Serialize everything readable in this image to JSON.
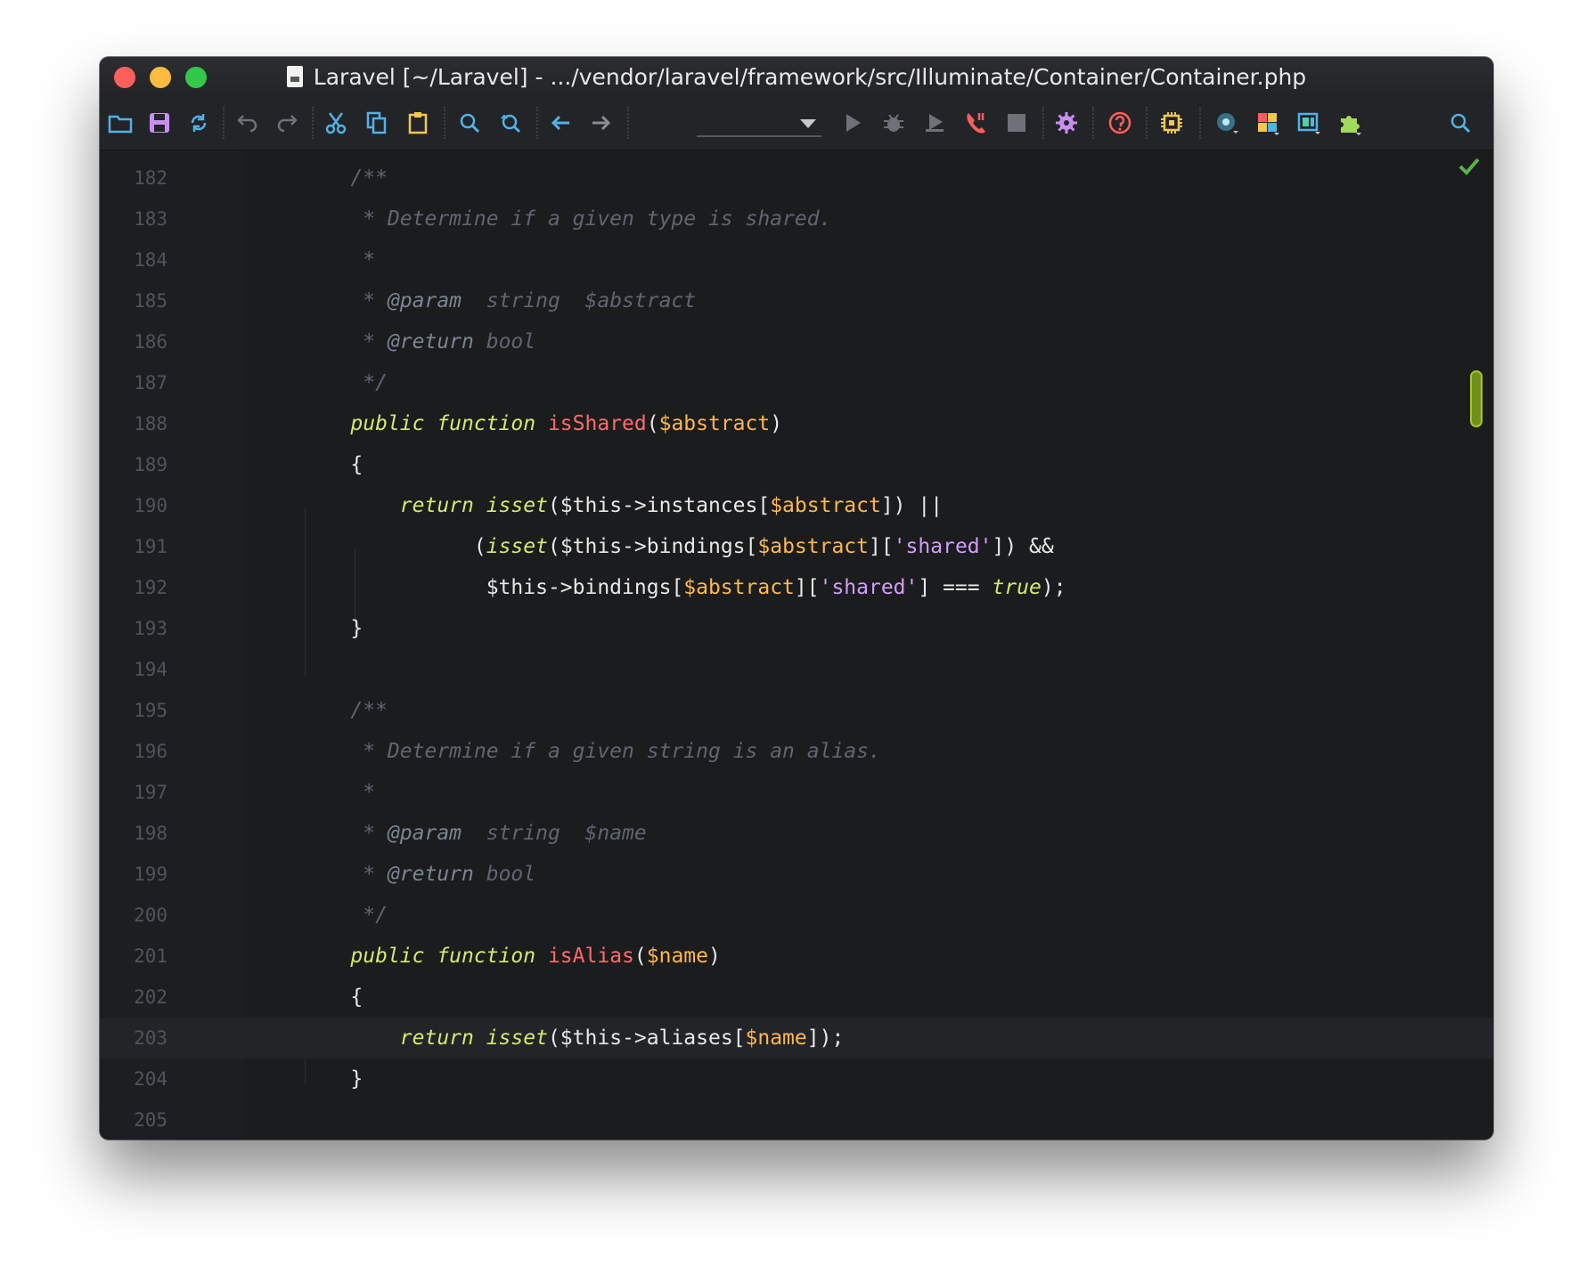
{
  "window": {
    "title": "Laravel [~/Laravel] - .../vendor/laravel/framework/src/Illuminate/Container/Container.php"
  },
  "toolbar": {
    "buttons": [
      {
        "name": "open-folder-icon"
      },
      {
        "name": "save-icon"
      },
      {
        "name": "sync-icon"
      },
      {
        "name": "undo-icon"
      },
      {
        "name": "redo-icon"
      },
      {
        "name": "cut-icon"
      },
      {
        "name": "copy-icon"
      },
      {
        "name": "paste-icon"
      },
      {
        "name": "find-icon"
      },
      {
        "name": "replace-icon"
      },
      {
        "name": "back-icon"
      },
      {
        "name": "forward-icon"
      },
      {
        "name": "run-icon"
      },
      {
        "name": "debug-icon"
      },
      {
        "name": "run-coverage-icon"
      },
      {
        "name": "stop-listening-icon"
      },
      {
        "name": "stop-icon"
      },
      {
        "name": "settings-icon"
      },
      {
        "name": "help-icon"
      },
      {
        "name": "cpu-icon"
      },
      {
        "name": "vcs-icon"
      },
      {
        "name": "structure-icon"
      },
      {
        "name": "database-icon"
      },
      {
        "name": "plugins-icon"
      },
      {
        "name": "search-everywhere-icon"
      }
    ],
    "run_config_value": ""
  },
  "colors": {
    "background": "#1b1c1e",
    "comment": "#5f6670",
    "keyword": "#d3ea6f",
    "function": "#ff6b6b",
    "variable": "#ffb84d",
    "string": "#d49cff"
  },
  "editor": {
    "lines": [
      {
        "n": "182",
        "t": [
          [
            "c",
            "    /**"
          ]
        ]
      },
      {
        "n": "183",
        "t": [
          [
            "c",
            "     * Determine if a given type is shared."
          ]
        ]
      },
      {
        "n": "184",
        "t": [
          [
            "c",
            "     *"
          ]
        ]
      },
      {
        "n": "185",
        "t": [
          [
            "c",
            "     * "
          ],
          [
            "tag",
            "@param"
          ],
          [
            "c",
            "  string  $abstract"
          ]
        ]
      },
      {
        "n": "186",
        "t": [
          [
            "c",
            "     * "
          ],
          [
            "tag",
            "@return"
          ],
          [
            "c",
            " bool"
          ]
        ]
      },
      {
        "n": "187",
        "t": [
          [
            "c",
            "     */"
          ]
        ]
      },
      {
        "n": "188",
        "t": [
          [
            "kw",
            "    public function "
          ],
          [
            "fn",
            "isShared"
          ],
          [
            "op",
            "("
          ],
          [
            "var",
            "$abstract"
          ],
          [
            "op",
            ")"
          ]
        ]
      },
      {
        "n": "189",
        "t": [
          [
            "op",
            "    {"
          ]
        ]
      },
      {
        "n": "190",
        "t": [
          [
            "kw",
            "        return isset"
          ],
          [
            "op",
            "($this->instances["
          ],
          [
            "var",
            "$abstract"
          ],
          [
            "op",
            "]) ||"
          ]
        ]
      },
      {
        "n": "191",
        "t": [
          [
            "op",
            "              ("
          ],
          [
            "kw",
            "isset"
          ],
          [
            "op",
            "($this->bindings["
          ],
          [
            "var",
            "$abstract"
          ],
          [
            "op",
            "]["
          ],
          [
            "str",
            "'shared'"
          ],
          [
            "op",
            "]) &&"
          ]
        ]
      },
      {
        "n": "192",
        "t": [
          [
            "op",
            "               $this->bindings["
          ],
          [
            "var",
            "$abstract"
          ],
          [
            "op",
            "]["
          ],
          [
            "str",
            "'shared'"
          ],
          [
            "op",
            "] === "
          ],
          [
            "kw",
            "true"
          ],
          [
            "op",
            ");"
          ]
        ]
      },
      {
        "n": "193",
        "t": [
          [
            "op",
            "    }"
          ]
        ]
      },
      {
        "n": "194",
        "t": [
          [
            "op",
            ""
          ]
        ]
      },
      {
        "n": "195",
        "t": [
          [
            "c",
            "    /**"
          ]
        ]
      },
      {
        "n": "196",
        "t": [
          [
            "c",
            "     * Determine if a given string is an alias."
          ]
        ]
      },
      {
        "n": "197",
        "t": [
          [
            "c",
            "     *"
          ]
        ]
      },
      {
        "n": "198",
        "t": [
          [
            "c",
            "     * "
          ],
          [
            "tag",
            "@param"
          ],
          [
            "c",
            "  string  $name"
          ]
        ]
      },
      {
        "n": "199",
        "t": [
          [
            "c",
            "     * "
          ],
          [
            "tag",
            "@return"
          ],
          [
            "c",
            " bool"
          ]
        ]
      },
      {
        "n": "200",
        "t": [
          [
            "c",
            "     */"
          ]
        ]
      },
      {
        "n": "201",
        "t": [
          [
            "kw",
            "    public function "
          ],
          [
            "fn",
            "isAlias"
          ],
          [
            "op",
            "("
          ],
          [
            "var",
            "$name"
          ],
          [
            "op",
            ")"
          ]
        ]
      },
      {
        "n": "202",
        "t": [
          [
            "op",
            "    {"
          ]
        ]
      },
      {
        "n": "203",
        "t": [
          [
            "kw",
            "        return isset"
          ],
          [
            "op",
            "($this->aliases["
          ],
          [
            "var",
            "$name"
          ],
          [
            "op",
            "]);"
          ]
        ]
      },
      {
        "n": "204",
        "t": [
          [
            "op",
            "    }"
          ]
        ]
      },
      {
        "n": "205",
        "t": [
          [
            "op",
            ""
          ]
        ]
      }
    ],
    "current_line": "203"
  }
}
